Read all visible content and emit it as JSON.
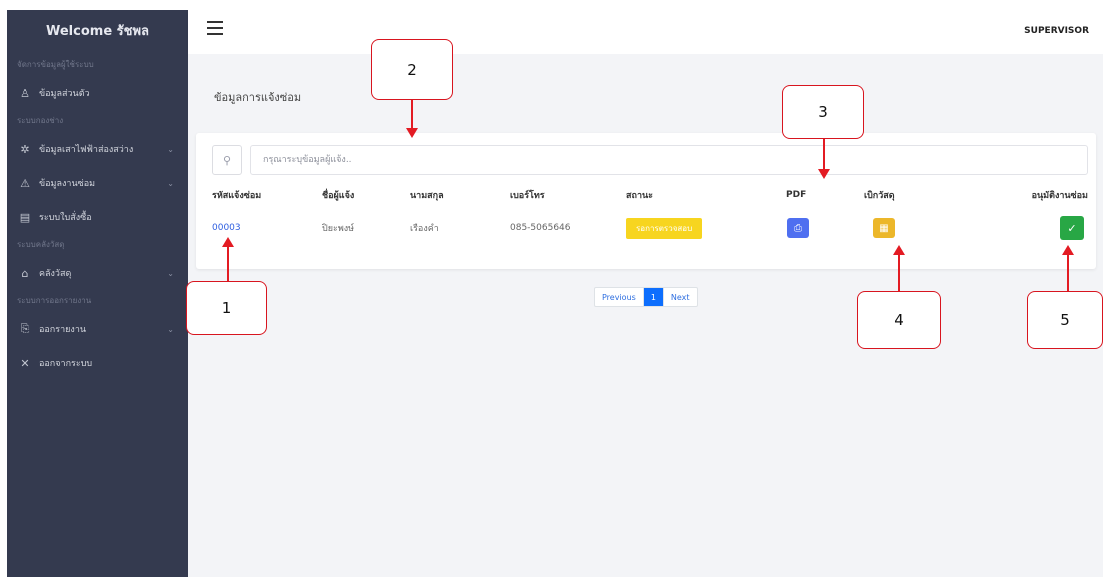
{
  "sidebar": {
    "title": "Welcome รัชพล",
    "sections": [
      {
        "heading": "จัดการข้อมูลผู้ใช้ระบบ",
        "items": [
          {
            "label": "ข้อมูลส่วนตัว",
            "icon": "user-icon"
          }
        ]
      },
      {
        "heading": "ระบบกองช่าง",
        "items": [
          {
            "label": "ข้อมูลเสาไฟฟ้าส่องสว่าง",
            "icon": "sun-icon",
            "chevron": "⌄"
          },
          {
            "label": "ข้อมูลงานซ่อม",
            "icon": "warning-icon",
            "chevron": "⌄"
          },
          {
            "label": "ระบบใบสั่งซื้อ",
            "icon": "document-icon"
          }
        ]
      },
      {
        "heading": "ระบบคลังวัสดุ",
        "items": [
          {
            "label": "คลังวัสดุ",
            "icon": "home-icon",
            "chevron": "⌄"
          }
        ]
      },
      {
        "heading": "ระบบการออกรายงาน",
        "items": [
          {
            "label": "ออกรายงาน",
            "icon": "report-icon",
            "chevron": "⌄"
          },
          {
            "label": "ออกจากระบบ",
            "icon": "close-icon"
          }
        ]
      }
    ]
  },
  "topbar": {
    "role": "SUPERVISOR"
  },
  "page": {
    "title": "ข้อมูลการแจ้งซ่อม"
  },
  "search": {
    "placeholder": "กรุณาระบุข้อมูลผู้แจ้ง.."
  },
  "table": {
    "headers": {
      "id": "รหัสแจ้งซ่อม",
      "name": "ชื่อผู้แจ้ง",
      "surname": "นามสกุล",
      "phone": "เบอร์โทร",
      "status": "สถานะ",
      "pdf": "PDF",
      "withdraw": "เบิกวัสดุ",
      "approve": "อนุมัติงานซ่อม"
    },
    "rows": [
      {
        "id": "00003",
        "name": "ปิยะพงษ์",
        "surname": "เรืองคำ",
        "phone": "085-5065646",
        "status": "รอการตรวจสอบ"
      }
    ]
  },
  "pagination": {
    "previous": "Previous",
    "current": "1",
    "next": "Next"
  },
  "annotations": [
    "1",
    "2",
    "3",
    "4",
    "5"
  ],
  "colors": {
    "sidebar_bg": "#343a4f",
    "status_badge": "#f7d51f",
    "pdf_button": "#4f6ff0",
    "withdraw_button": "#ecb72a",
    "approve_button": "#28a745",
    "annotation": "#e31b23"
  }
}
